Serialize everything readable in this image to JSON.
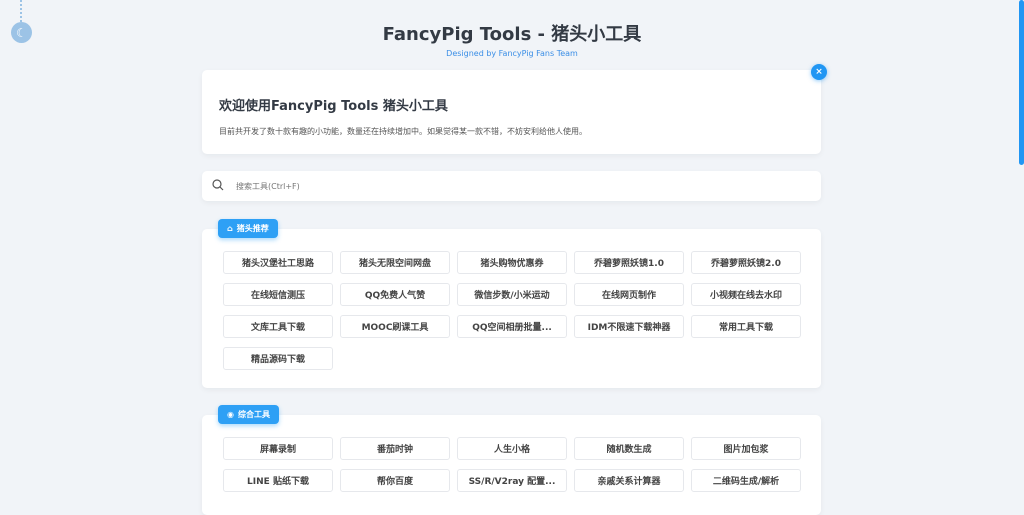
{
  "header": {
    "title": "FancyPig Tools - 猪头小工具",
    "subtitle": "Designed by FancyPig Fans Team"
  },
  "welcome": {
    "title": "欢迎使用FancyPig Tools 猪头小工具",
    "text": "目前共开发了数十款有趣的小功能，数量还在持续增加中。如果觉得某一款不错，不妨安利给他人使用。",
    "close": "×"
  },
  "search": {
    "placeholder": "搜索工具(Ctrl+F)"
  },
  "sections": [
    {
      "title": "猪头推荐",
      "icon": "home-icon",
      "tools": [
        "猪头汉堡社工思路",
        "猪头无限空间网盘",
        "猪头购物优惠券",
        "乔碧萝照妖镜1.0",
        "乔碧萝照妖镜2.0",
        "在线短信测压",
        "QQ免费人气赞",
        "微信步数/小米运动",
        "在线网页制作",
        "小视频在线去水印",
        "文库工具下载",
        "MOOC刷课工具",
        "QQ空间相册批量...",
        "IDM不限速下载神器",
        "常用工具下载",
        "精品源码下载"
      ]
    },
    {
      "title": "综合工具",
      "icon": "layers-icon",
      "tools": [
        "屏幕录制",
        "番茄时钟",
        "人生小格",
        "随机数生成",
        "图片加包浆",
        "LINE 贴纸下载",
        "帮你百度",
        "SS/R/V2ray 配置...",
        "亲戚关系计算器",
        "二维码生成/解析"
      ]
    }
  ],
  "colors": {
    "accent": "#2196f3",
    "badge": "#2ea0f5"
  }
}
